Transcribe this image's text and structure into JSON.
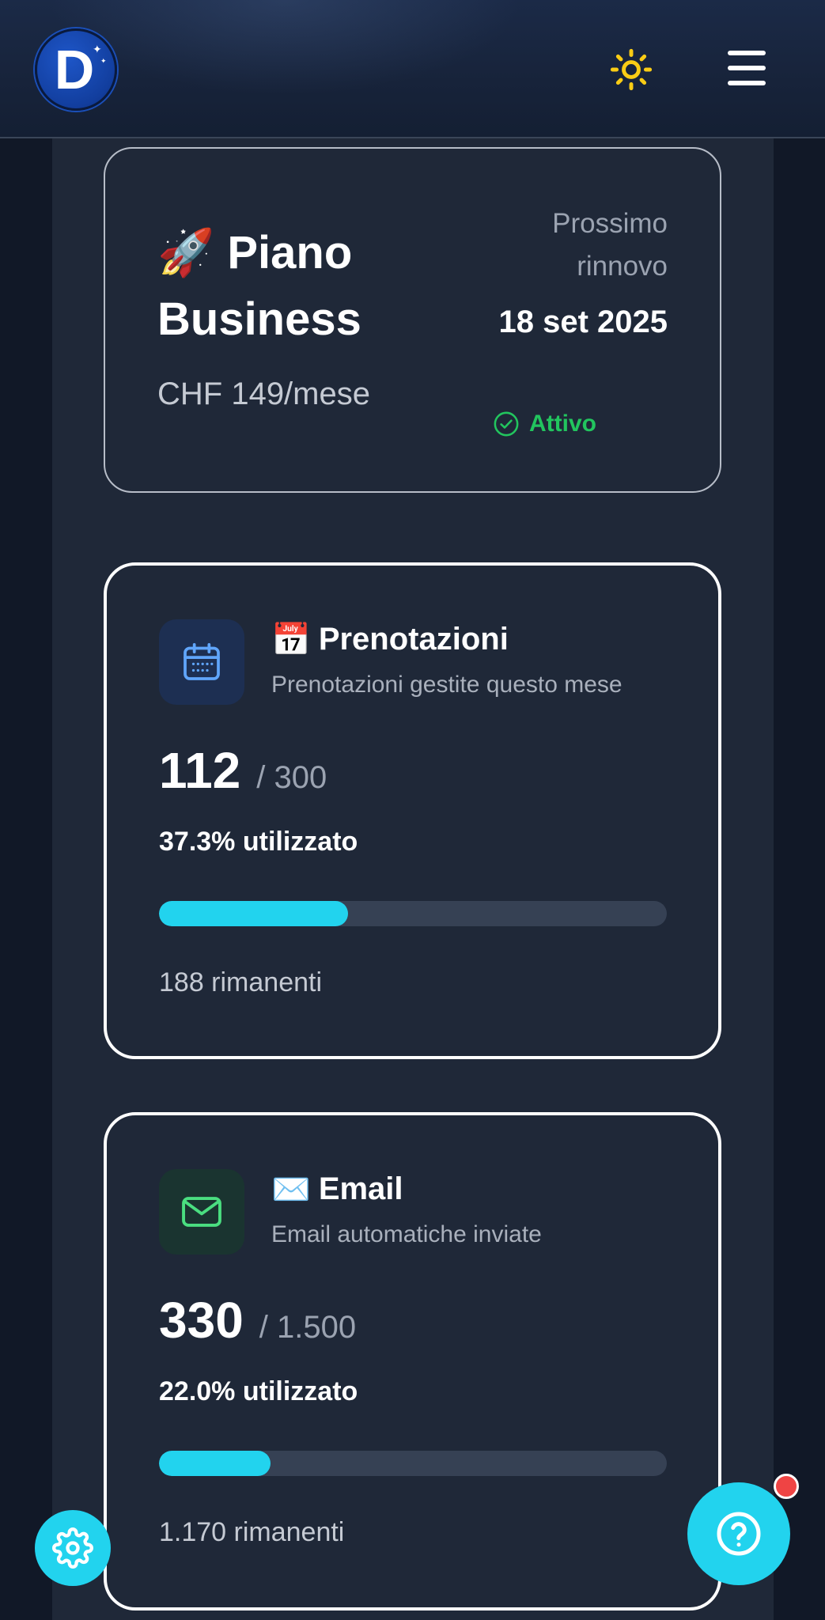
{
  "header": {
    "logo_letter": "D",
    "theme_icon": "sun-icon",
    "menu_icon": "hamburger-menu-icon"
  },
  "plan": {
    "emoji": "🚀",
    "name": "Piano Business",
    "price": "CHF 149/mese",
    "renewal_label": "Prossimo rinnovo",
    "renewal_date": "18 set 2025",
    "status": "Attivo"
  },
  "usage": [
    {
      "icon": "calendar-icon",
      "emoji": "📅",
      "title": "Prenotazioni",
      "description": "Prenotazioni gestite questo mese",
      "used": "112",
      "limit": "/ 300",
      "percent_label": "37.3% utilizzato",
      "percent": 37.3,
      "remaining": "188 rimanenti"
    },
    {
      "icon": "mail-icon",
      "emoji": "✉️",
      "title": "Email",
      "description": "Email automatiche inviate",
      "used": "330",
      "limit": "/ 1.500",
      "percent_label": "22.0% utilizzato",
      "percent": 22.0,
      "remaining": "1.170 rimanenti"
    }
  ],
  "colors": {
    "accent": "#22d3ee",
    "active_green": "#22c55e",
    "background": "#1f2838",
    "notification": "#ef4444"
  },
  "floating": {
    "settings_icon": "gear-icon",
    "help_icon": "question-icon",
    "has_notification": true
  }
}
